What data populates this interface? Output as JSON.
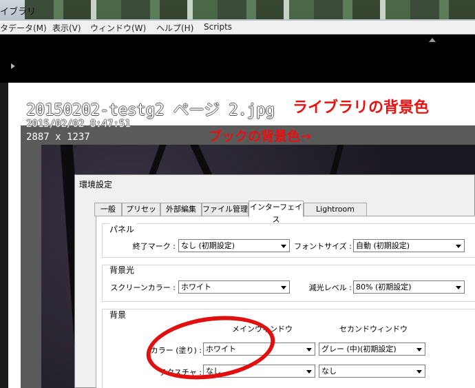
{
  "window": {
    "title_fragment": "イブラリ"
  },
  "menu": [
    "タデータ(M)",
    "表示(V)",
    "ウィンドウ(W)",
    "ヘルプ(H)",
    "Scripts"
  ],
  "photo": {
    "filename": "20150202-testg2 ページ 2.jpg",
    "datetime": "2015/02/02 8:47:51",
    "dimensions": "2887 x 1237"
  },
  "annotations": {
    "library_bg": "ライブラリの背景色",
    "book_bg": "ブックの背景色→"
  },
  "dialog": {
    "title": "環境設定",
    "tabs": [
      "一般",
      "プリセット",
      "外部編集",
      "ファイル管理",
      "インターフェイス",
      "Lightroom mobile"
    ],
    "active_tab": "インターフェイス",
    "panel": {
      "label": "パネル",
      "end_mark_label": "終了マーク :",
      "end_mark_value": "なし (初期設定)",
      "font_size_label": "フォントサイズ :",
      "font_size_value": "自動 (初期設定)"
    },
    "backlight": {
      "label": "背景光",
      "screen_color_label": "スクリーンカラー :",
      "screen_color_value": "ホワイト",
      "dim_level_label": "減光レベル :",
      "dim_level_value": "80% (初期設定)"
    },
    "background": {
      "label": "背景",
      "main_window_label": "メインウィンドウ",
      "second_window_label": "セカンドウィンドウ",
      "color_label": "カラー (塗り) :",
      "color_main_value": "ホワイト",
      "color_second_value": "グレー (中)(初期設定)",
      "texture_label": "テクスチャ :",
      "texture_main_value": "なし",
      "texture_second_value": "なし"
    }
  },
  "colors": {
    "annotation": "#e81010",
    "library_bg": "#ffffff",
    "book_bg": "#5a5a5a"
  }
}
